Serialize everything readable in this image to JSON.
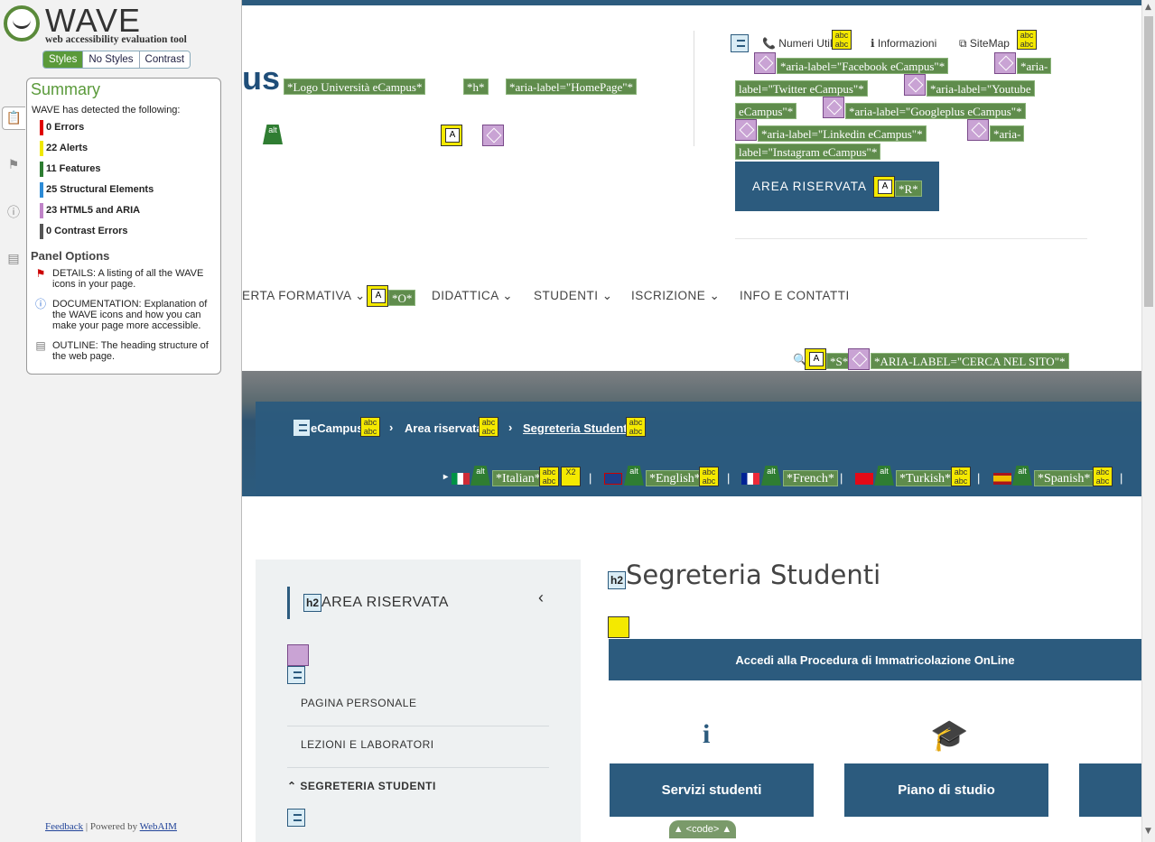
{
  "wave": {
    "logo_title": "WAVE",
    "logo_subtitle": "web accessibility evaluation tool",
    "tabs": [
      "Styles",
      "No Styles",
      "Contrast"
    ],
    "summary_title": "Summary",
    "detected_text": "WAVE has detected the following:",
    "counts": [
      {
        "label": "0 Errors",
        "color": "#e00000"
      },
      {
        "label": "22 Alerts",
        "color": "#f0e800"
      },
      {
        "label": "11 Features",
        "color": "#2e7d32"
      },
      {
        "label": "25 Structural Elements",
        "color": "#2c8bd6"
      },
      {
        "label": "23 HTML5 and ARIA",
        "color": "#c084c8"
      },
      {
        "label": "0 Contrast Errors",
        "color": "#555555"
      }
    ],
    "panel_options_title": "Panel Options",
    "options": [
      "DETAILS: A listing of all the WAVE icons in your page.",
      "DOCUMENTATION: Explanation of the WAVE icons and how you can make your page more accessible.",
      "OUTLINE: The heading structure of the web page."
    ],
    "footer_feedback": "Feedback",
    "footer_sep": " | Powered by ",
    "footer_webaim": "WebAIM"
  },
  "page": {
    "logo_partial": "us",
    "wave_labels_header": [
      "*Logo Università eCampus*",
      "*h*",
      "*aria-label=\"HomePage\"*"
    ],
    "top_links": [
      "Numeri Utili",
      "Informazioni",
      "SiteMap"
    ],
    "social_labels": [
      "*aria-label=\"Facebook eCampus\"*",
      "*aria-",
      "label=\"Twitter eCampus\"*",
      "*aria-label=\"Youtube",
      "eCampus\"*",
      "*aria-label=\"Googleplus eCampus\"*",
      "*aria-label=\"Linkedin eCampus\"*",
      "*aria-",
      "label=\"Instagram eCampus\"*"
    ],
    "area_riservata_btn": "AREA RISERVATA",
    "area_riservata_r": "*R*",
    "nav": [
      "ERTA FORMATIVA",
      "DIDATTICA",
      "STUDENTI",
      "ISCRIZIONE",
      "INFO E CONTATTI"
    ],
    "nav_label_o": "*O*",
    "search_labels": [
      "*S*",
      "*ARIA-LABEL=\"CERCA NEL SITO\"*"
    ],
    "breadcrumbs": [
      "eCampus",
      "Area riservata",
      "Segreteria Studenti"
    ],
    "languages": [
      "*Italian*",
      "*English*",
      "*French*",
      "*Turkish*",
      "*Spanish*"
    ],
    "sidebar_heading": "AREA RISERVATA",
    "sidebar_items": [
      "PAGINA PERSONALE",
      "LEZIONI E LABORATORI",
      "SEGRETERIA STUDENTI"
    ],
    "main_heading": "Segreteria Studenti",
    "immatricolazione_btn": "Accedi alla Procedura di Immatricolazione OnLine",
    "cards": [
      "Servizi studenti",
      "Piano di studio"
    ],
    "code_toggle": "▲ <code> ▲"
  }
}
